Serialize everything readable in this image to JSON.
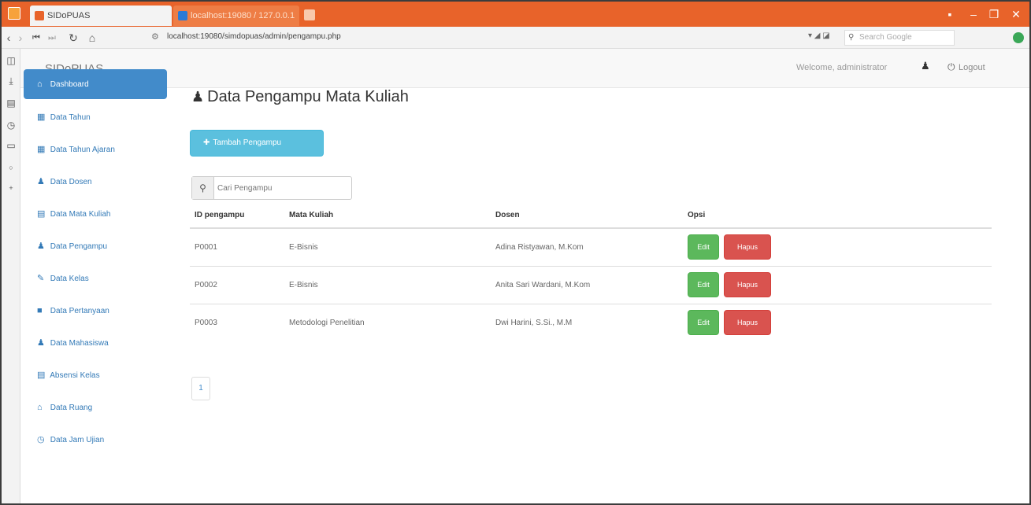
{
  "browser": {
    "tabs": [
      {
        "label": "SIDoPUAS",
        "active": true
      },
      {
        "label": "localhost:19080 / 127.0.0.1",
        "active": false
      }
    ],
    "address": "localhost:19080/simdopuas/admin/pengampu.php",
    "search_placeholder": "Search Google",
    "window_controls": {
      "min": "–",
      "max": "❐",
      "close": "✕"
    }
  },
  "app": {
    "brand": "SIDoPUAS",
    "welcome": "Welcome, administrator",
    "logout": "Logout"
  },
  "sidebar": {
    "items": [
      {
        "label": "Dashboard",
        "icon": "home-icon",
        "glyph": "⌂",
        "active": true
      },
      {
        "label": "Data Tahun",
        "icon": "calendar-icon",
        "glyph": "▦"
      },
      {
        "label": "Data Tahun Ajaran",
        "icon": "calendar-icon",
        "glyph": "▦"
      },
      {
        "label": "Data Dosen",
        "icon": "user-icon",
        "glyph": "♟"
      },
      {
        "label": "Data Mata Kuliah",
        "icon": "book-icon",
        "glyph": "▤"
      },
      {
        "label": "Data Pengampu",
        "icon": "user-icon",
        "glyph": "♟"
      },
      {
        "label": "Data Kelas",
        "icon": "pencil-icon",
        "glyph": "✎"
      },
      {
        "label": "Data Pertanyaan",
        "icon": "question-icon",
        "glyph": "■"
      },
      {
        "label": "Data Mahasiswa",
        "icon": "user-icon",
        "glyph": "♟"
      },
      {
        "label": "Absensi Kelas",
        "icon": "list-icon",
        "glyph": "▤"
      },
      {
        "label": "Data Ruang",
        "icon": "home-icon",
        "glyph": "⌂"
      },
      {
        "label": "Data Jam Ujian",
        "icon": "clock-icon",
        "glyph": "◷"
      }
    ]
  },
  "main": {
    "title": "Data Pengampu Mata Kuliah",
    "add_button": "Tambah Pengampu",
    "search_placeholder": "Cari Pengampu",
    "table": {
      "headers": [
        "ID pengampu",
        "Mata Kuliah",
        "Dosen",
        "Opsi"
      ],
      "rows": [
        {
          "id": "P0001",
          "mk": "E-Bisnis",
          "dosen": "Adina Ristyawan, M.Kom"
        },
        {
          "id": "P0002",
          "mk": "E-Bisnis",
          "dosen": "Anita Sari Wardani, M.Kom"
        },
        {
          "id": "P0003",
          "mk": "Metodologi Penelitian",
          "dosen": "Dwi Harini, S.Si., M.M"
        }
      ],
      "edit_label": "Edit",
      "delete_label": "Hapus"
    },
    "pagination": "1"
  }
}
